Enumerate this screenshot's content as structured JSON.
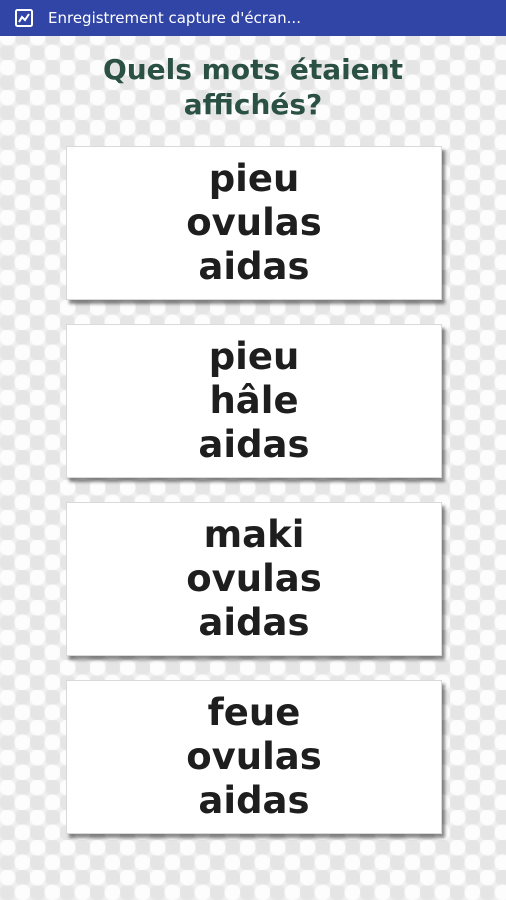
{
  "status_bar": {
    "title": "Enregistrement capture d'écran...",
    "icon": "screen-record-icon",
    "color": "#3045a6"
  },
  "question": {
    "line1": "Quels mots étaient",
    "line2": "affichés?",
    "color": "#2b5145"
  },
  "answers": [
    {
      "words": [
        "pieu",
        "ovulas",
        "aidas"
      ]
    },
    {
      "words": [
        "pieu",
        "hâle",
        "aidas"
      ]
    },
    {
      "words": [
        "maki",
        "ovulas",
        "aidas"
      ]
    },
    {
      "words": [
        "feue",
        "ovulas",
        "aidas"
      ]
    }
  ]
}
